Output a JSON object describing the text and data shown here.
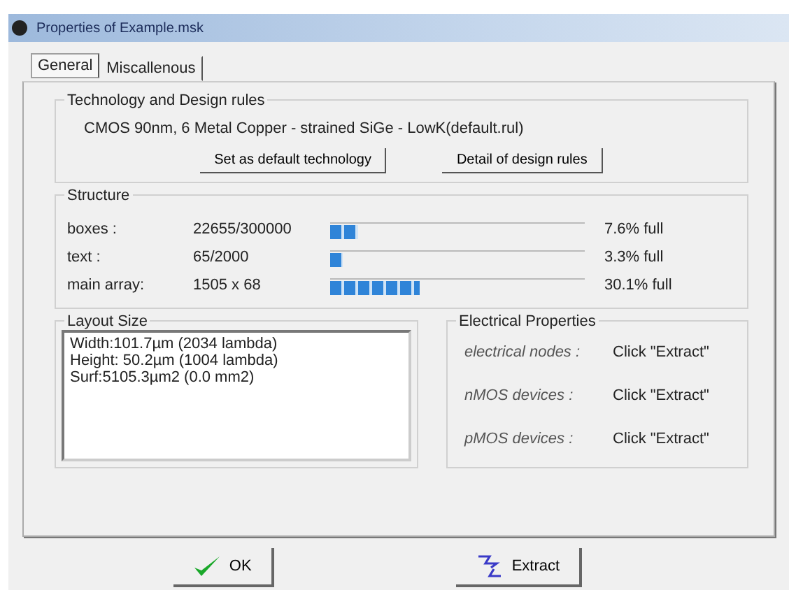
{
  "window": {
    "title": "Properties of Example.msk"
  },
  "tabs": [
    {
      "label": "General",
      "selected": true
    },
    {
      "label": "Miscallenous",
      "selected": false
    }
  ],
  "technology": {
    "title": "Technology and Design rules",
    "description": "CMOS 90nm, 6 Metal Copper - strained SiGe - LowK(default.rul)",
    "buttons": [
      "Set as default technology",
      "Detail of design rules"
    ]
  },
  "structure": {
    "title": "Structure",
    "rows": [
      {
        "label": "boxes :",
        "value": "22655/300000",
        "level": 0.11,
        "reading": "7.6% full"
      },
      {
        "label": "text :",
        "value": "65/2000",
        "level": 0.05,
        "reading": "3.3% full"
      },
      {
        "label": "main array:",
        "value": "1505 x 68",
        "level": 0.35,
        "reading": "30.1% full"
      }
    ]
  },
  "layout_size": {
    "title": "Layout Size",
    "lines": [
      "Width:101.7µm (2034 lambda)",
      "Height: 50.2µm (1004 lambda)",
      "Surf:5105.3µm2 (0.0 mm2)"
    ]
  },
  "electrical": {
    "title": "Electrical Properties",
    "rows": [
      {
        "label": "electrical nodes :",
        "value": "Click \"Extract\""
      },
      {
        "label": "nMOS devices :",
        "value": "Click \"Extract\""
      },
      {
        "label": "pMOS devices :",
        "value": "Click \"Extract\""
      }
    ]
  },
  "buttons": [
    {
      "kind": "ok",
      "label": "OK"
    },
    {
      "kind": "extract",
      "label": "Extract"
    }
  ]
}
